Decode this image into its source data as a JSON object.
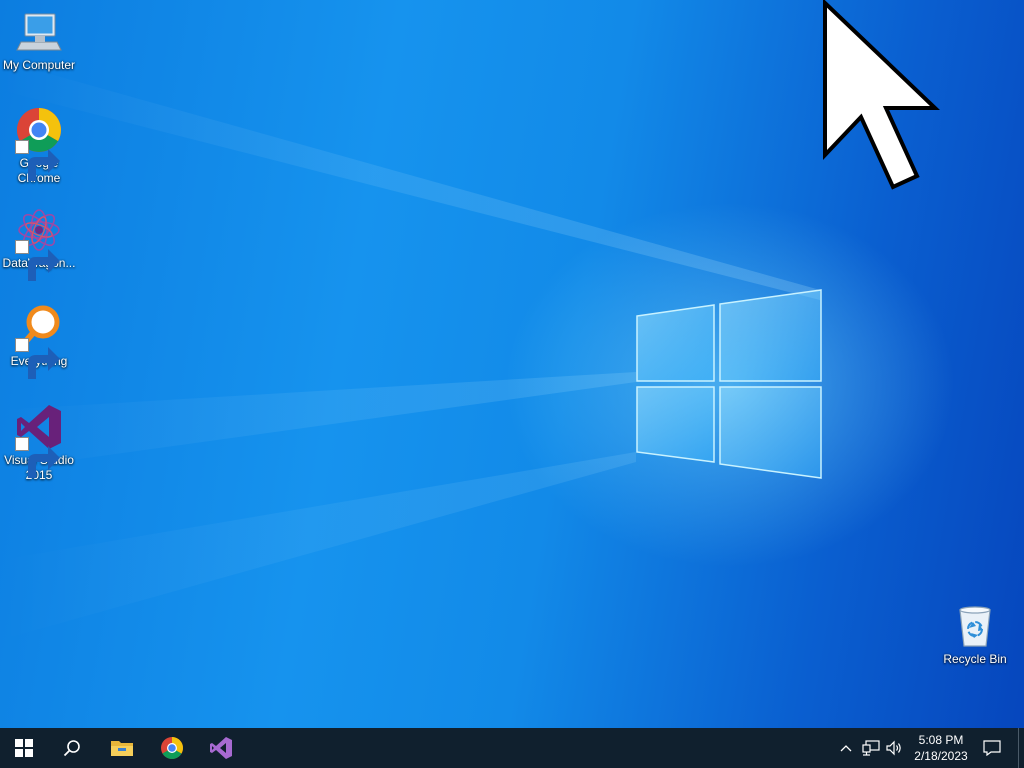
{
  "desktop": {
    "icons": [
      {
        "label": "My Computer",
        "icon": "computer-icon",
        "shortcut": false
      },
      {
        "label": "Google Chrome",
        "icon": "chrome-icon",
        "shortcut": true
      },
      {
        "label": "DataWagon...",
        "icon": "datawagon-icon",
        "shortcut": true
      },
      {
        "label": "Everything",
        "icon": "everything-search-icon",
        "shortcut": true
      },
      {
        "label": "Visual Studio 2015",
        "icon": "visual-studio-icon",
        "shortcut": true
      }
    ],
    "recycle_bin": {
      "label": "Recycle Bin",
      "icon": "recycle-bin-icon"
    }
  },
  "taskbar": {
    "start_icon": "windows-logo-icon",
    "search_icon": "search-icon",
    "pinned": [
      {
        "name": "File Explorer",
        "icon": "file-explorer-icon"
      },
      {
        "name": "Google Chrome",
        "icon": "chrome-icon"
      },
      {
        "name": "Visual Studio",
        "icon": "visual-studio-icon"
      }
    ],
    "tray": {
      "icons": [
        "chevron-up-icon",
        "network-icon",
        "volume-icon"
      ],
      "clock": {
        "time": "5:08 PM",
        "date": "2/18/2023"
      },
      "notification_icon": "action-center-icon"
    }
  },
  "colors": {
    "taskbar_bg": "#10202e",
    "wallpaper_base": "#0c7de0",
    "chrome_red": "#db4437",
    "chrome_green": "#0f9d58",
    "chrome_yellow": "#f4c20d",
    "chrome_blue": "#4285f4",
    "vs_purple": "#68217a",
    "everything_orange": "#f08a1c"
  }
}
